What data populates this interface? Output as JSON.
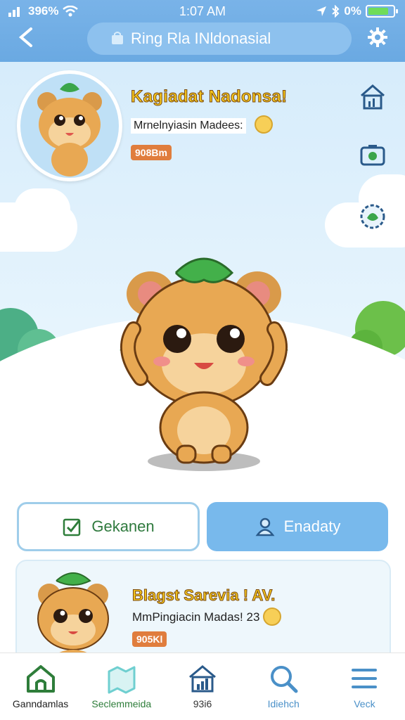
{
  "status_bar": {
    "carrier": "396%",
    "time": "1:07 AM",
    "battery_text": "0%"
  },
  "header": {
    "title": "Ring Rla INldonasial"
  },
  "profile": {
    "name": "Kagiadat Nadonsa!",
    "subtitle": "Mrnelnyiasin Madees:",
    "badge": "908Bm"
  },
  "actions": {
    "primary_outline_label": "Gekanen",
    "primary_filled_label": "Enadaty"
  },
  "card": {
    "title": "Blagst Sarevia ! AV.",
    "subtitle": "MmPingiacin Madas! 23",
    "badge": "905Kl"
  },
  "nav": {
    "items": [
      {
        "label": "Ganndamlas",
        "color": "#2e7d3a",
        "icon": "home-icon"
      },
      {
        "label": "Seclemmeida",
        "color": "#2e7d3a",
        "icon": "map-icon"
      },
      {
        "label": "93i6",
        "color": "#333333",
        "icon": "stats-house-icon"
      },
      {
        "label": "Idiehch",
        "color": "#4a90c8",
        "icon": "search-icon"
      },
      {
        "label": "Veck",
        "color": "#4a90c8",
        "icon": "menu-icon"
      }
    ]
  },
  "colors": {
    "header": "#6aa9e2",
    "accent_blue": "#78b9ec",
    "accent_green": "#2e7d3a",
    "badge": "#e07d3d",
    "title_yellow": "#f3c51c"
  }
}
